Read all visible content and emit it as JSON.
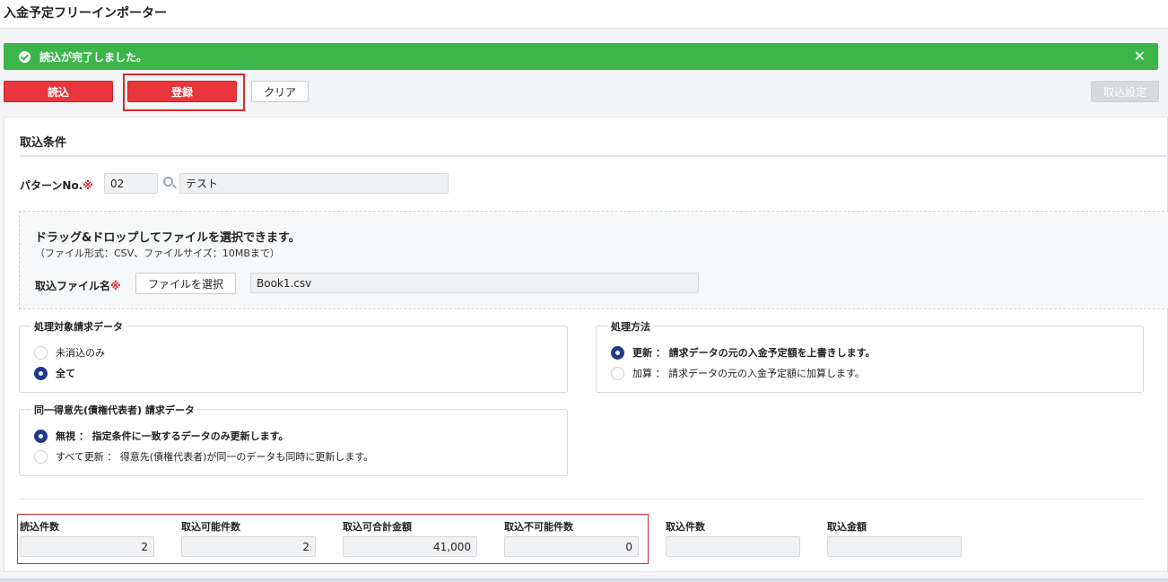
{
  "page": {
    "title": "入金予定フリーインポーター"
  },
  "alert": {
    "message": "読込が完了しました。",
    "close": "✕"
  },
  "toolbar": {
    "read_label": "読込",
    "register_label": "登録",
    "clear_label": "クリア",
    "import_settings_label": "取込設定"
  },
  "conditions": {
    "title": "取込条件",
    "pattern_label": "パターンNo.",
    "required_mark": "※",
    "pattern_no": "02",
    "pattern_name": "テスト"
  },
  "dropzone": {
    "title": "ドラッグ&ドロップしてファイルを選択できます。",
    "subtitle": "（ファイル形式：CSV、ファイルサイズ：10MBまで）",
    "file_label": "取込ファイル名",
    "select_button": "ファイルを選択",
    "file_name": "Book1.csv"
  },
  "target_data": {
    "title": "処理対象請求データ",
    "options": [
      {
        "label": "未消込のみ",
        "selected": false
      },
      {
        "label": "全て",
        "selected": true
      }
    ]
  },
  "method": {
    "title": "処理方法",
    "options": [
      {
        "label": "更新 ： 請求データの元の入金予定額を上書きします。",
        "selected": true
      },
      {
        "label": "加算 ： 請求データの元の入金予定額に加算します。",
        "selected": false
      }
    ]
  },
  "same_customer": {
    "title": "同一得意先(債権代表者) 請求データ",
    "options": [
      {
        "label": "無視 ： 指定条件に一致するデータのみ更新します。",
        "selected": true
      },
      {
        "label": "すべて更新 ： 得意先(債権代表者)が同一のデータも同時に更新します。",
        "selected": false
      }
    ]
  },
  "stats": {
    "read_count_label": "読込件数",
    "read_count": "2",
    "importable_count_label": "取込可能件数",
    "importable_count": "2",
    "importable_total_label": "取込可合計金額",
    "importable_total": "41,000",
    "not_importable_label": "取込不可能件数",
    "not_importable": "0",
    "import_count_label": "取込件数",
    "import_count": "",
    "import_amount_label": "取込金額",
    "import_amount": ""
  },
  "colors": {
    "primary_red": "#e8363c",
    "success_green": "#3cb54a",
    "radio_navy": "#1f3a8a"
  }
}
